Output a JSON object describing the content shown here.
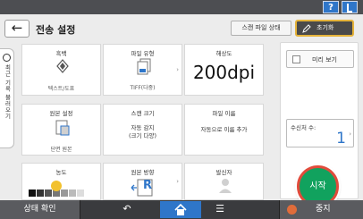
{
  "header": {
    "help_label": "?",
    "title": "전송 설정",
    "scan_status": "스캔 파일 상태",
    "reset": "초기화"
  },
  "side_tab": {
    "label": "최근 기록 불러오기"
  },
  "cards": {
    "color": {
      "label": "흑백",
      "sub": "텍스트/도표"
    },
    "file_type": {
      "label": "파일 유형",
      "sub": "TIFF(다중)"
    },
    "resolution": {
      "label": "해상도",
      "value": "200dpi"
    },
    "original_settings": {
      "label": "원본 설정",
      "sub": "단면 원본"
    },
    "scan_size": {
      "label": "스캔 크기",
      "line1": "자동 감지",
      "line2": "(크기 다양)"
    },
    "file_name": {
      "label": "파일 이름",
      "value": "자동으로 이름 추가"
    },
    "density": {
      "label": "농도"
    },
    "orientation": {
      "label": "원본 방향",
      "icon_text": "R"
    },
    "sender": {
      "label": "발신자"
    }
  },
  "right_panel": {
    "preview": "미리 보기",
    "recipients_label": "수신처 수:",
    "recipients_count": "1",
    "start": "시작"
  },
  "bottom": {
    "status_check": "상태 확인",
    "stop": "중지"
  },
  "colors": {
    "accent_blue": "#2f76c9",
    "start_green": "#11a25e",
    "start_ring": "#e14b3b",
    "reset_border": "#e5b33a"
  }
}
